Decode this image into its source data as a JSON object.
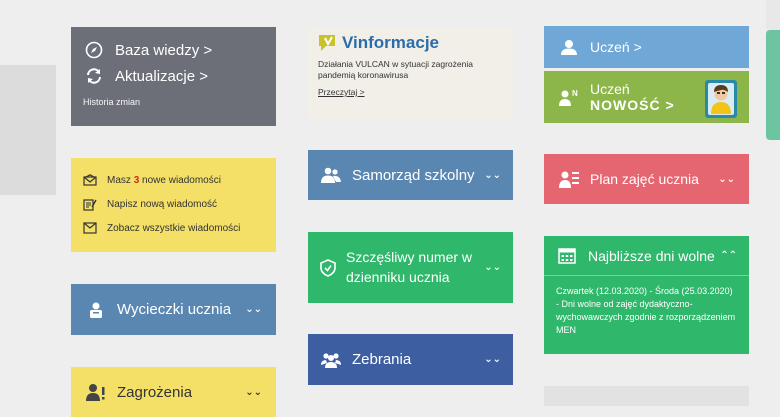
{
  "colors": {
    "grey": "#6d6f78",
    "yellow": "#f4e067",
    "blue": "#5a87b1",
    "green": "#2fb86b",
    "navy": "#3e5ea2",
    "lightblue": "#6fa8d6",
    "olive": "#8db64a",
    "red": "#e56570"
  },
  "baza": {
    "baza_wiedzy": "Baza wiedzy >",
    "aktualizacje": "Aktualizacje >",
    "historia": "Historia zmian",
    "icons": [
      "compass-icon",
      "refresh-icon"
    ]
  },
  "messages": {
    "prefix": "Masz",
    "count": "3",
    "suffix": "nowe wiadomości",
    "write": "Napisz nową wiadomość",
    "all": "Zobacz wszystkie wiadomości",
    "icons": [
      "envelope-icon",
      "edit-icon",
      "inbox-icon"
    ]
  },
  "wycieczki": {
    "label": "Wycieczki ucznia",
    "icon": "briefcase-icon"
  },
  "zagrozenia": {
    "label": "Zagrożenia",
    "icon": "user-alert-icon"
  },
  "vinformacje": {
    "brand": "Vinformacje",
    "desc": "Działania VULCAN w sytuacji zagrożenia pandemią koronawirusa",
    "more": "Przeczytaj >"
  },
  "samorzad": {
    "label": "Samorząd szkolny",
    "icon": "users-icon"
  },
  "szczesliwy": {
    "label": "Szczęśliwy numer w dzienniku ucznia",
    "icon": "shield-icon"
  },
  "zebrania": {
    "label": "Zebrania",
    "icon": "users-icon"
  },
  "uczen": {
    "label": "Uczeń >",
    "icon": "user-icon"
  },
  "uczen_new": {
    "line1": "Uczeń",
    "line2": "NOWOŚĆ >",
    "icon": "user-new-icon"
  },
  "plan": {
    "label": "Plan zajęć ucznia",
    "icon": "user-list-icon"
  },
  "dni_wolne": {
    "label": "Najbliższe dni wolne",
    "text": "Czwartek (12.03.2020) - Środa (25.03.2020) - Dni wolne od zajęć dydaktyczno-wychowawczych zgodnie z rozporządzeniem MEN",
    "icon": "calendar-icon"
  },
  "chevrons": {
    "down": "⌄⌄",
    "up": "⌃⌃"
  }
}
